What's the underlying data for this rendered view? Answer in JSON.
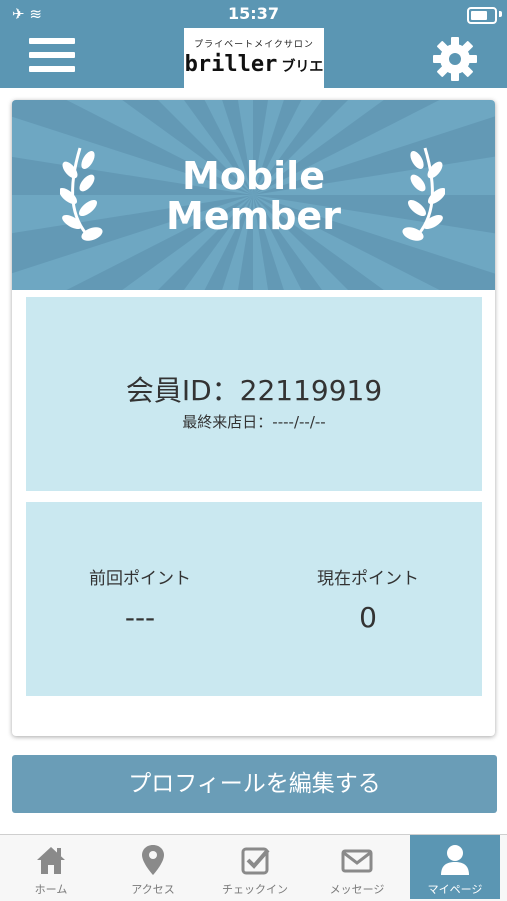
{
  "status_bar": {
    "time": "15:37"
  },
  "header": {
    "logo_subtitle": "プライベートメイクサロン",
    "logo_name": "briller",
    "logo_kana": "ブリエ"
  },
  "banner": {
    "line1": "Mobile",
    "line2": "Member"
  },
  "member": {
    "id_label": "会員ID：",
    "id_value": "22119919",
    "last_visit_label": "最終来店日：",
    "last_visit_value": "----/--/--"
  },
  "points": {
    "previous_label": "前回ポイント",
    "previous_value": "---",
    "current_label": "現在ポイント",
    "current_value": "0"
  },
  "edit_profile_button": "プロフィールを編集する",
  "tabs": [
    {
      "label": "ホーム",
      "icon": "home-icon"
    },
    {
      "label": "アクセス",
      "icon": "map-pin-icon"
    },
    {
      "label": "チェックイン",
      "icon": "check-square-icon"
    },
    {
      "label": "メッセージ",
      "icon": "envelope-icon"
    },
    {
      "label": "マイページ",
      "icon": "user-icon",
      "active": true
    }
  ],
  "colors": {
    "primary": "#5b96b3",
    "panel": "#cae8f0",
    "button": "#6a9db7"
  }
}
